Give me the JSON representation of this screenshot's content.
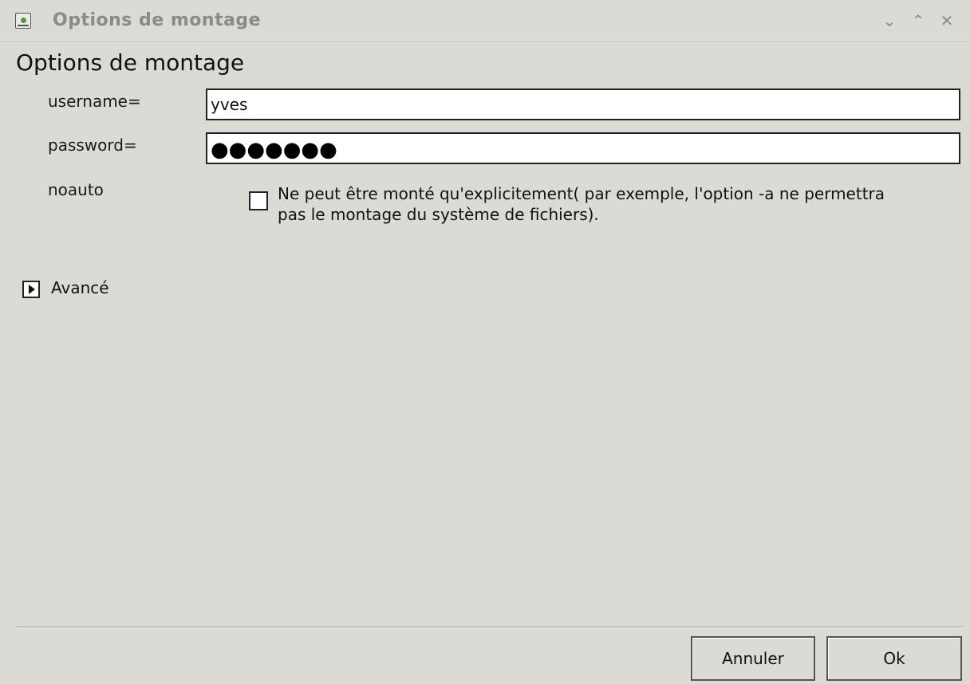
{
  "window": {
    "title": "Options de montage",
    "controls": {
      "minimize": "⌄",
      "maximize": "⌃",
      "close": "✕"
    }
  },
  "heading": "Options de montage",
  "fields": {
    "username": {
      "label": "username=",
      "value": "yves"
    },
    "password": {
      "label": "password=",
      "masked_value": "●●●●●●●"
    },
    "noauto": {
      "label": "noauto",
      "checked": false,
      "description": "Ne peut être monté qu'explicitement( par exemple, l'option -a ne permettra pas le montage du système de fichiers)."
    }
  },
  "advanced": {
    "label": "Avancé",
    "expanded": false
  },
  "buttons": {
    "cancel": "Annuler",
    "ok": "Ok"
  },
  "icons": {
    "app": "app-icon",
    "expander": "triangle-right-icon"
  }
}
